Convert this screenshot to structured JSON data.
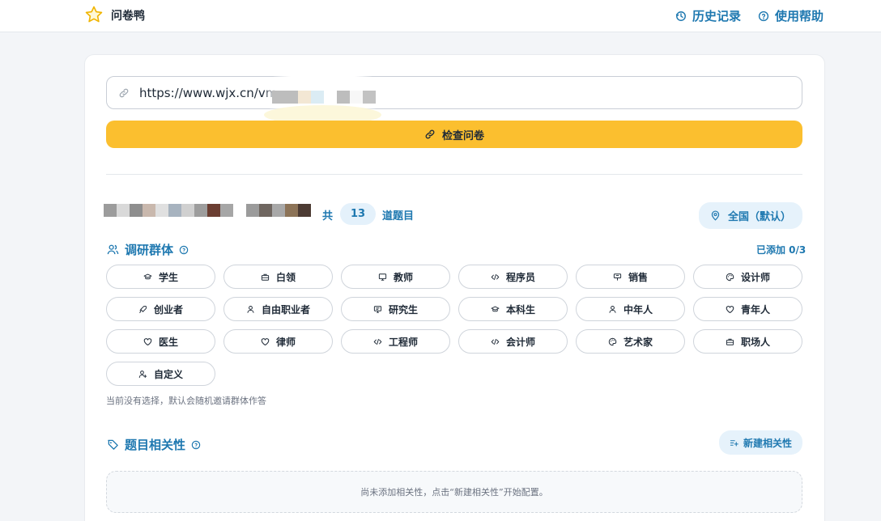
{
  "header": {
    "app_name": "问卷鸭",
    "history_label": "历史记录",
    "help_label": "使用帮助"
  },
  "url_input": {
    "value": "https://www.wjx.cn/vm/"
  },
  "check_button": {
    "label": "检查问卷"
  },
  "survey": {
    "total_prefix": "共",
    "question_count": "13",
    "total_suffix": "道题目",
    "region_label": "全国（默认）"
  },
  "audience": {
    "title": "调研群体",
    "added_text": "已添加 0/3",
    "chips": [
      {
        "label": "学生",
        "icon": "graduation-cap-icon"
      },
      {
        "label": "白领",
        "icon": "briefcase-icon"
      },
      {
        "label": "教师",
        "icon": "presentation-icon"
      },
      {
        "label": "程序员",
        "icon": "code-icon"
      },
      {
        "label": "销售",
        "icon": "sign-icon"
      },
      {
        "label": "设计师",
        "icon": "palette-icon"
      },
      {
        "label": "创业者",
        "icon": "rocket-icon"
      },
      {
        "label": "自由职业者",
        "icon": "user-icon"
      },
      {
        "label": "研究生",
        "icon": "monitor-icon"
      },
      {
        "label": "本科生",
        "icon": "graduation-cap-icon"
      },
      {
        "label": "中年人",
        "icon": "user-icon"
      },
      {
        "label": "青年人",
        "icon": "heart-icon"
      },
      {
        "label": "医生",
        "icon": "heart-icon"
      },
      {
        "label": "律师",
        "icon": "heart-icon"
      },
      {
        "label": "工程师",
        "icon": "code-icon"
      },
      {
        "label": "会计师",
        "icon": "code-icon"
      },
      {
        "label": "艺术家",
        "icon": "palette-icon"
      },
      {
        "label": "职场人",
        "icon": "briefcase-icon"
      },
      {
        "label": "自定义",
        "icon": "user-plus-icon"
      }
    ],
    "hint": "当前没有选择，默认会随机邀请群体作答"
  },
  "relevance": {
    "title": "题目相关性",
    "new_button_label": "新建相关性",
    "empty_text": "尚未添加相关性，点击“新建相关性”开始配置。"
  },
  "colors": {
    "accent": "#1e78b0",
    "primary_button": "#fbbf2f",
    "background": "#f3f5f8"
  }
}
